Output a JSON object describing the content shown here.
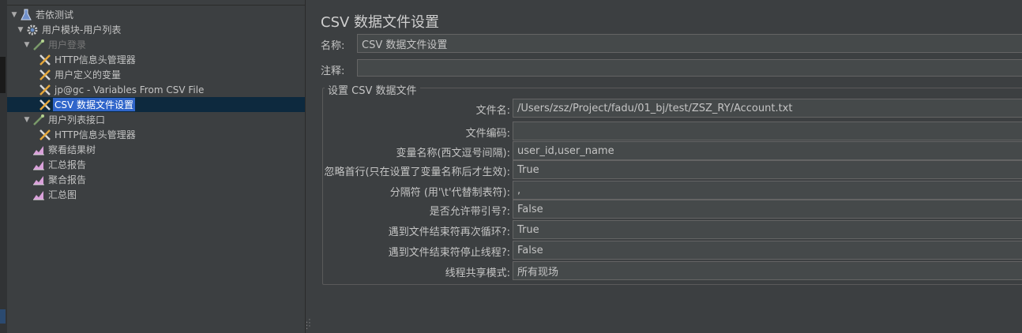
{
  "tree": {
    "items": [
      {
        "label": "若依测试",
        "icon": "test-plan-icon"
      },
      {
        "label": "用户模块-用户列表",
        "icon": "thread-group-gear-icon"
      },
      {
        "label": "用户登录",
        "icon": "sampler-pipette-icon"
      },
      {
        "label": "HTTP信息头管理器",
        "icon": "config-wrench-icon"
      },
      {
        "label": "用户定义的变量",
        "icon": "config-wrench-icon"
      },
      {
        "label": "jp@gc - Variables From CSV File",
        "icon": "config-wrench-icon"
      },
      {
        "label": "CSV 数据文件设置",
        "icon": "config-wrench-icon"
      },
      {
        "label": "用户列表接口",
        "icon": "sampler-pipette-icon"
      },
      {
        "label": "HTTP信息头管理器",
        "icon": "config-wrench-icon"
      },
      {
        "label": "察看结果树",
        "icon": "listener-graph-icon"
      },
      {
        "label": "汇总报告",
        "icon": "listener-graph-icon"
      },
      {
        "label": "聚合报告",
        "icon": "listener-graph-icon"
      },
      {
        "label": "汇总图",
        "icon": "listener-graph-icon"
      }
    ]
  },
  "panel": {
    "title": "CSV 数据文件设置",
    "name_label": "名称:",
    "name_value": "CSV 数据文件设置",
    "comment_label": "注释:",
    "comment_value": "",
    "group_title": "设置 CSV 数据文件"
  },
  "props": [
    {
      "label": "文件名:",
      "value": "/Users/zsz/Project/fadu/01_bj/test/ZSZ_RY/Account.txt"
    },
    {
      "label": "文件编码:",
      "value": ""
    },
    {
      "label": "变量名称(西文逗号间隔):",
      "value": "user_id,user_name"
    },
    {
      "label": "忽略首行(只在设置了变量名称后才生效):",
      "value": "True"
    },
    {
      "label": "分隔符 (用'\\t'代替制表符):",
      "value": ","
    },
    {
      "label": "是否允许带引号?:",
      "value": "False"
    },
    {
      "label": "遇到文件结束符再次循环?:",
      "value": "True"
    },
    {
      "label": "遇到文件结束符停止线程?:",
      "value": "False"
    },
    {
      "label": "线程共享模式:",
      "value": "所有现场"
    }
  ],
  "colors": {
    "background": "#3c3f41",
    "field": "#45494a",
    "selection": "#2f65ca",
    "selected_row": "#0d293e"
  }
}
